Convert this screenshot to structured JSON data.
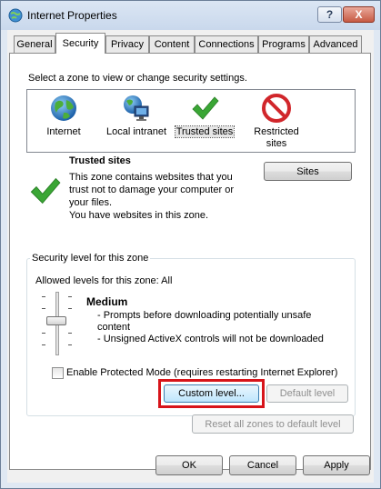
{
  "window": {
    "title": "Internet Properties",
    "help_glyph": "?",
    "close_glyph": "X"
  },
  "tabs": [
    "General",
    "Security",
    "Privacy",
    "Content",
    "Connections",
    "Programs",
    "Advanced"
  ],
  "active_tab": "Security",
  "security": {
    "zone_prompt": "Select a zone to view or change security settings.",
    "zones": [
      {
        "label": "Internet",
        "icon": "globe-icon"
      },
      {
        "label": "Local intranet",
        "icon": "intranet-icon"
      },
      {
        "label": "Trusted sites",
        "icon": "checkmark-icon",
        "selected": true
      },
      {
        "label": "Restricted sites",
        "label_line1": "Restricted",
        "label_line2": "sites",
        "icon": "no-entry-icon"
      }
    ],
    "zone_title": "Trusted sites",
    "zone_desc": [
      "This zone contains websites that you",
      "trust not to damage your computer or",
      "your files.",
      "You have websites in this zone."
    ],
    "sites_button": "Sites",
    "level_group_title": "Security level for this zone",
    "allowed_levels": "Allowed levels for this zone: All",
    "level_name": "Medium",
    "level_bullets": [
      "- Prompts before downloading potentially unsafe",
      "content",
      "- Unsigned ActiveX controls will not be downloaded"
    ],
    "protected_mode_label": "Enable Protected Mode (requires restarting Internet Explorer)",
    "protected_mode_checked": false,
    "custom_level_button": "Custom level...",
    "default_level_button": "Default level",
    "reset_all_button": "Reset all zones to default level"
  },
  "footer": {
    "ok": "OK",
    "cancel": "Cancel",
    "apply": "Apply"
  },
  "colors": {
    "highlight_border": "#d7141a",
    "check_green": "#3aa635",
    "restricted_red": "#d1262b"
  }
}
